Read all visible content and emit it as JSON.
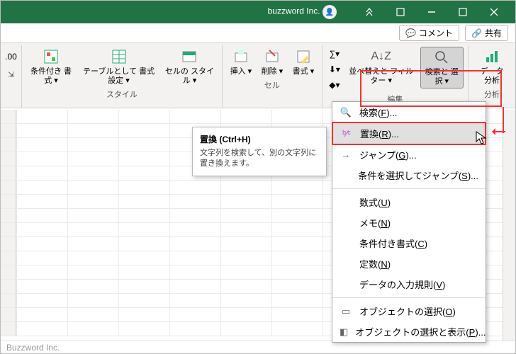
{
  "titlebar": {
    "title": "buzzword Inc."
  },
  "sharerow": {
    "comment": "コメント",
    "share": "共有"
  },
  "ribbon": {
    "leftnum_label": "",
    "styles": {
      "cond": "条件付き\n書式 ▾",
      "table": "テーブルとして\n書式設定 ▾",
      "cell": "セルの\nスタイル ▾",
      "label": "スタイル"
    },
    "cells": {
      "ins": "挿入\n▾",
      "del": "削除\n▾",
      "fmt": "書式\n▾",
      "label": "セル"
    },
    "editing": {
      "sort": "並べ替えと\nフィルター ▾",
      "find": "検索と\n選択 ▾",
      "label": "編集"
    },
    "analysis": {
      "btn": "データ\n分析",
      "label": "分析"
    }
  },
  "tooltip": {
    "title": "置換 (Ctrl+H)",
    "body": "文字列を検索して、別の文字列に置き換えます。"
  },
  "menu": {
    "find": "検索(F)...",
    "replace": "置換(R)...",
    "goto": "ジャンプ(G)...",
    "gotospecial": "条件を選択してジャンプ(S)...",
    "formulas": "数式(U)",
    "notes": "メモ(N)",
    "condfmt": "条件付き書式(C)",
    "constants": "定数(N)",
    "datavalid": "データの入力規則(V)",
    "selobj": "オブジェクトの選択(O)",
    "selpane": "オブジェクトの選択と表示(P)..."
  },
  "status": {
    "brand": "Buzzword Inc."
  }
}
